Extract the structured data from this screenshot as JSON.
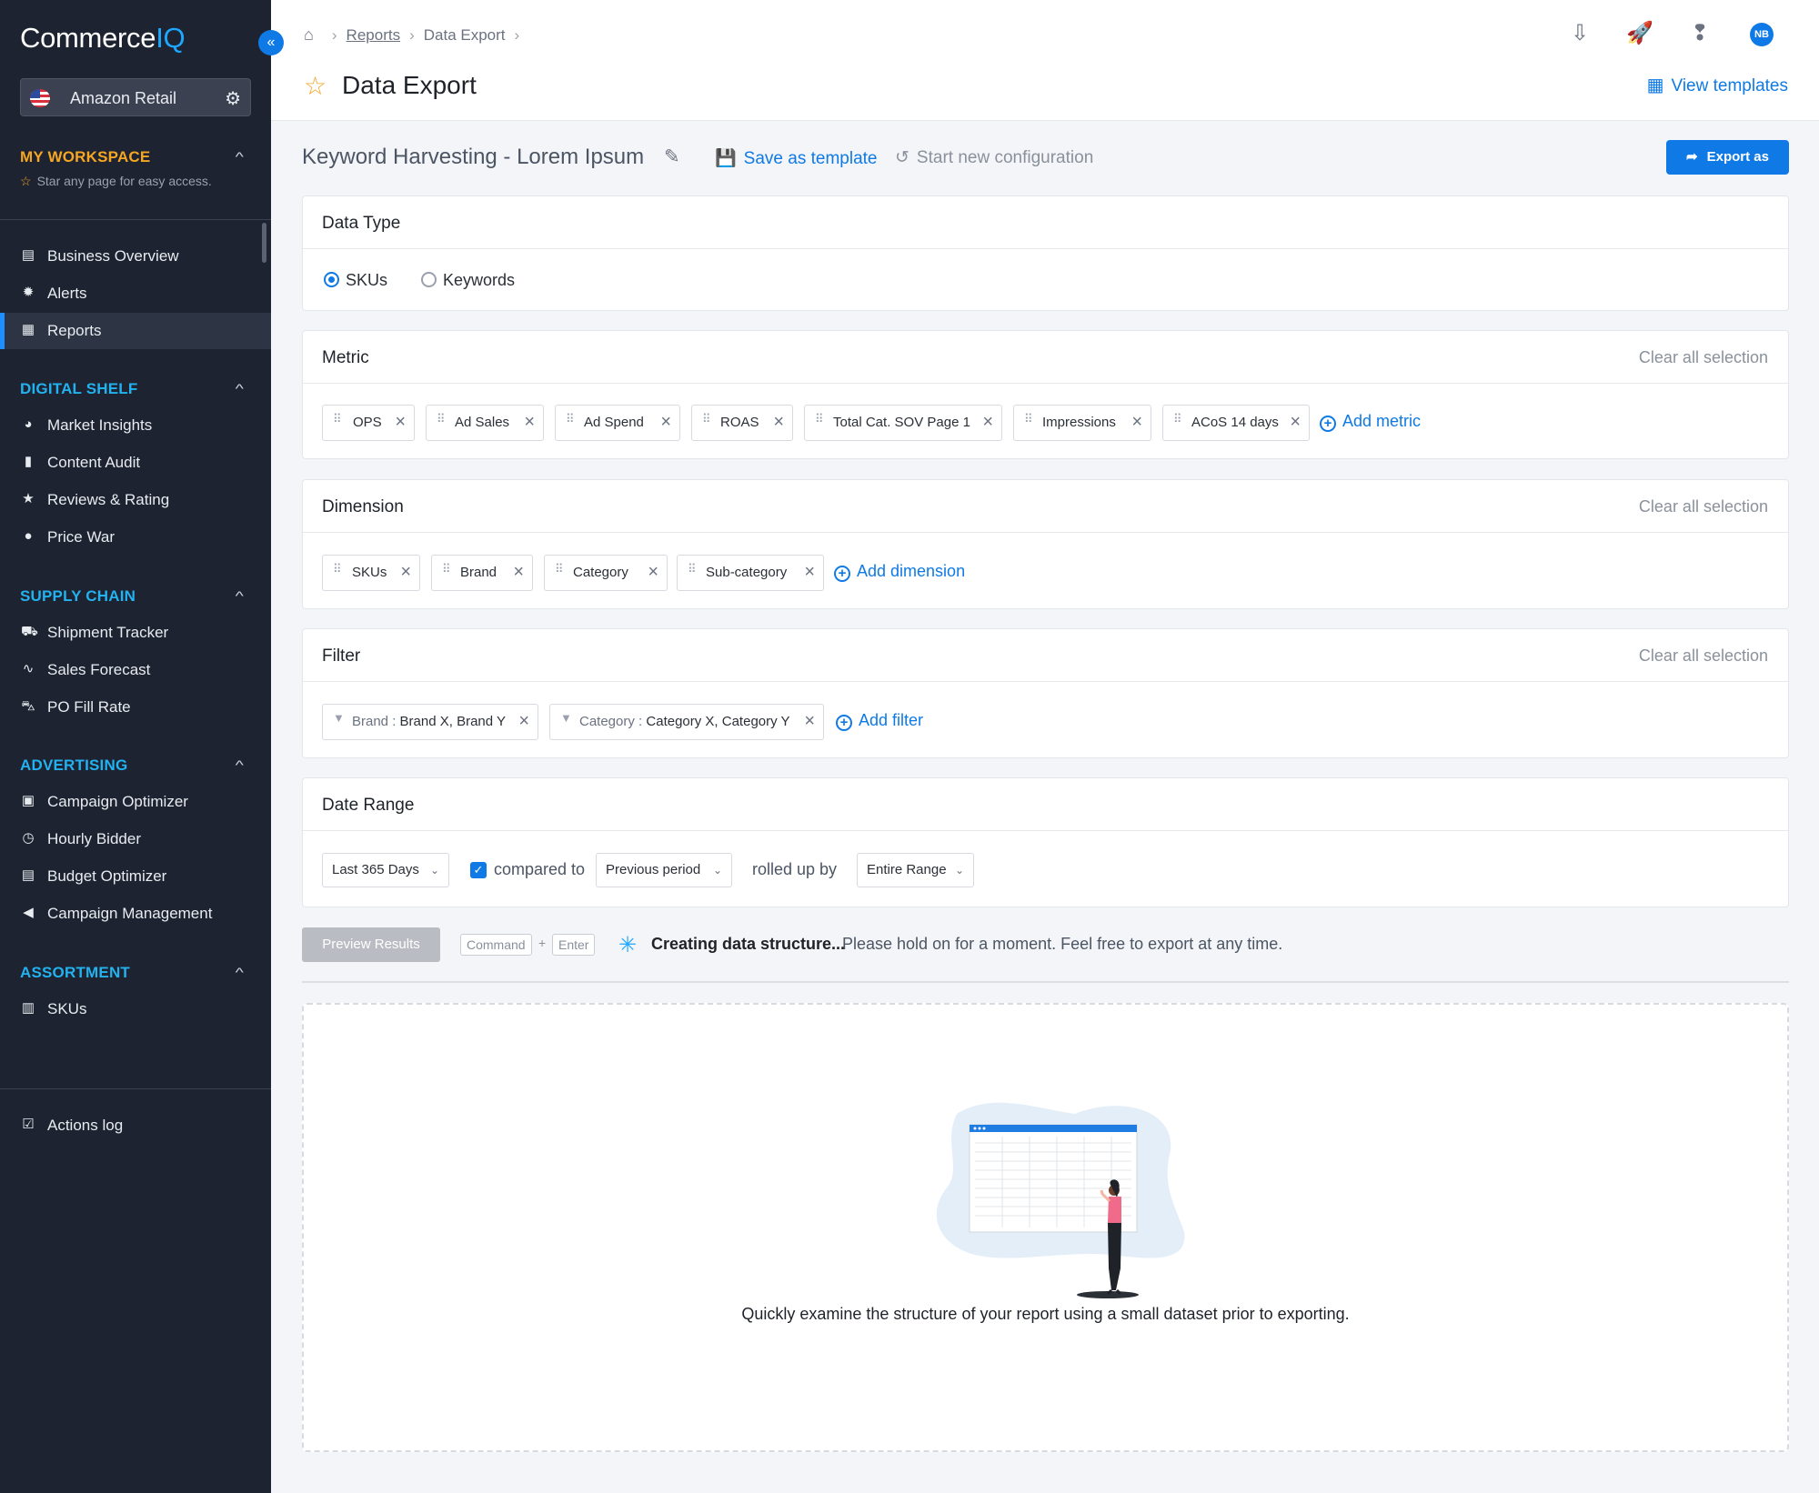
{
  "brand": {
    "name_part1": "Commerce",
    "name_part2": "IQ"
  },
  "sidebar": {
    "collapse_icon": "«",
    "retailer": "Amazon Retail",
    "workspace": {
      "title": "MY WORKSPACE",
      "hint": "Star any page for easy access."
    },
    "top_items": [
      {
        "label": "Business Overview",
        "icon": "store-icon"
      },
      {
        "label": "Alerts",
        "icon": "alert-icon"
      },
      {
        "label": "Reports",
        "icon": "report-icon",
        "active": true
      }
    ],
    "sections": [
      {
        "title": "DIGITAL SHELF",
        "items": [
          "Market Insights",
          "Content Audit",
          "Reviews & Rating",
          "Price War"
        ]
      },
      {
        "title": "SUPPLY CHAIN",
        "items": [
          "Shipment Tracker",
          "Sales Forecast",
          "PO Fill Rate"
        ]
      },
      {
        "title": "ADVERTISING",
        "items": [
          "Campaign Optimizer",
          "Hourly Bidder",
          "Budget Optimizer",
          "Campaign Management"
        ]
      },
      {
        "title": "ASSORTMENT",
        "items": [
          "SKUs"
        ]
      }
    ],
    "bottom_item": "Actions log"
  },
  "header": {
    "breadcrumb": [
      "Reports",
      "Data Export"
    ],
    "title": "Data Export",
    "avatar_initials": "NB",
    "view_templates": "View templates"
  },
  "toolbar": {
    "config_title": "Keyword Harvesting - Lorem Ipsum",
    "save_template": "Save as template",
    "start_new": "Start new configuration",
    "export": "Export as"
  },
  "data_type": {
    "title": "Data Type",
    "options": [
      "SKUs",
      "Keywords"
    ],
    "selected": "SKUs"
  },
  "metric": {
    "title": "Metric",
    "clear": "Clear all selection",
    "chips": [
      "OPS",
      "Ad Sales",
      "Ad Spend",
      "ROAS",
      "Total Cat. SOV Page 1",
      "Impressions",
      "ACoS 14 days"
    ],
    "add": "Add metric"
  },
  "dimension": {
    "title": "Dimension",
    "clear": "Clear all selection",
    "chips": [
      "SKUs",
      "Brand",
      "Category",
      "Sub-category"
    ],
    "add": "Add dimension"
  },
  "filter": {
    "title": "Filter",
    "clear": "Clear all selection",
    "chips": [
      {
        "key": "Brand",
        "value": "Brand X, Brand Y"
      },
      {
        "key": "Category",
        "value": "Category X, Category Y"
      }
    ],
    "add": "Add filter"
  },
  "date_range": {
    "title": "Date Range",
    "range": "Last 365 Days",
    "compared_label": "compared to",
    "compared_checked": true,
    "compare_value": "Previous period",
    "rolled_label": "rolled up by",
    "rolled_value": "Entire Range"
  },
  "preview": {
    "button": "Preview Results",
    "key1": "Command",
    "key_plus": "+",
    "key2": "Enter",
    "status_bold": "Creating data structure...",
    "status_text": "Please hold on for a moment. Feel free to export at any time.",
    "caption": "Quickly examine the structure of your report using a small dataset prior to exporting."
  },
  "colors": {
    "accent": "#0f7ae5",
    "sidebar_bg": "#1d2330",
    "workspace": "#f5a623",
    "section": "#23b2f0"
  }
}
